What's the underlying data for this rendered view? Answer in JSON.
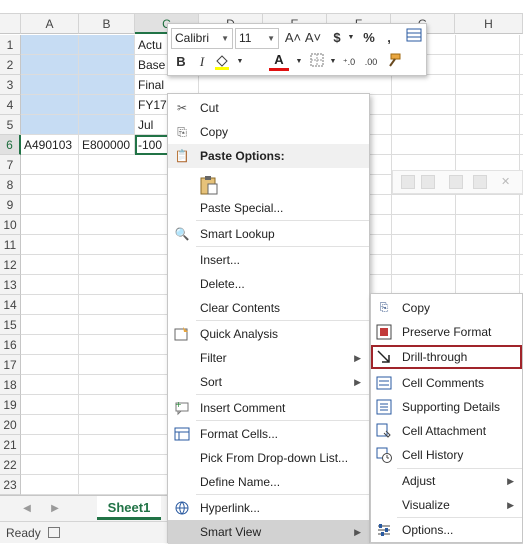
{
  "columns": [
    "A",
    "B",
    "C",
    "D",
    "E",
    "F",
    "G",
    "H"
  ],
  "rows": [
    "1",
    "2",
    "3",
    "4",
    "5",
    "6",
    "7",
    "8",
    "9",
    "10",
    "11",
    "12",
    "13",
    "14",
    "15",
    "16",
    "17",
    "18",
    "19",
    "20",
    "21",
    "22",
    "23"
  ],
  "cells": {
    "C1": "Actu",
    "C2": "Base",
    "C3": "Final",
    "C4": "FY17",
    "C5": "Jul",
    "A6": "A490103",
    "B6": "E800000",
    "C6": "-100"
  },
  "minitoolbar": {
    "font_name": "Calibri",
    "font_size": "11",
    "increase_font": "A˄",
    "decrease_font": "A˅",
    "currency": "$",
    "percent": "%",
    "comma": ",",
    "bold": "B",
    "italic": "I",
    "font_color": "A"
  },
  "context_menu": {
    "cut": "Cut",
    "copy": "Copy",
    "paste_options": "Paste Options:",
    "paste_special": "Paste Special...",
    "smart_lookup": "Smart Lookup",
    "insert": "Insert...",
    "delete": "Delete...",
    "clear_contents": "Clear Contents",
    "quick_analysis": "Quick Analysis",
    "filter": "Filter",
    "sort": "Sort",
    "insert_comment": "Insert Comment",
    "format_cells": "Format Cells...",
    "pick_from_list": "Pick From Drop-down List...",
    "define_name": "Define Name...",
    "hyperlink": "Hyperlink...",
    "smart_view": "Smart View"
  },
  "smart_view_menu": {
    "copy": "Copy",
    "preserve_format": "Preserve Format",
    "drill_through": "Drill-through",
    "cell_comments": "Cell Comments",
    "supporting_details": "Supporting Details",
    "cell_attachment": "Cell Attachment",
    "cell_history": "Cell History",
    "adjust": "Adjust",
    "visualize": "Visualize",
    "options": "Options..."
  },
  "sheet_tab": "Sheet1",
  "status": "Ready",
  "colors": {
    "excel_green": "#217346",
    "selection_blue": "#c6dcf3",
    "highlight_box": "#a0242a"
  }
}
